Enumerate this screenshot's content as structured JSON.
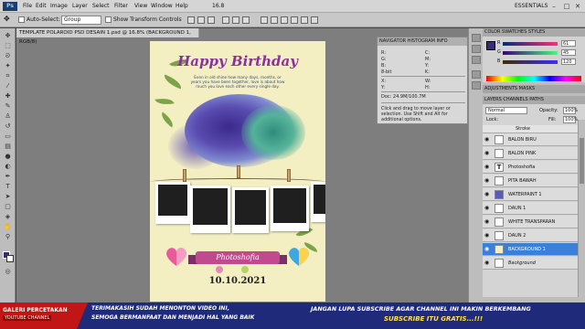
{
  "app": {
    "logo": "Ps",
    "zoom": "16.8",
    "workspace": "ESSENTIALS"
  },
  "menu": [
    "File",
    "Edit",
    "Image",
    "Layer",
    "Select",
    "Filter",
    "View",
    "Window",
    "Help"
  ],
  "options": {
    "auto_select_label": "Auto-Select:",
    "auto_select_value": "Group",
    "transform_label": "Show Transform Controls"
  },
  "document": {
    "tab_title": "TEMPLATE POLAROID PSD DESAIN 1.psd @ 16.8% (BACKGROUND 1, RGB/8)"
  },
  "canvas": {
    "heading": "Happy Birthday",
    "poem": "Even in old shine how many days, months, or years you have been together, love is about how much you love each other every single day.",
    "name": "Photoshofia",
    "date": "10.10.2021"
  },
  "nav_panel": {
    "tabs": "NAVIGATOR HISTOGRAM INFO",
    "r": "R:",
    "g": "G:",
    "b": "B:",
    "bit": "8-bit",
    "c": "C:",
    "m": "M:",
    "y": "Y:",
    "k": "K:",
    "x": "X:",
    "y2": "Y:",
    "w": "W:",
    "h": "H:",
    "doc": "Doc: 24.9M/100.7M",
    "hint": "Click and drag to move layer or selection. Use Shift and Alt for additional options."
  },
  "color_panel": {
    "tabs": "COLOR   SWATCHES   STYLES",
    "r_label": "R",
    "g_label": "G",
    "b_label": "B",
    "r": "61",
    "g": "45",
    "b": "120"
  },
  "adjust_panel": {
    "tabs": "ADJUSTMENTS   MASKS"
  },
  "layers_panel": {
    "tabs": "LAYERS   CHANNELS   PATHS",
    "blend": "Normal",
    "opacity_label": "Opacity:",
    "opacity": "100%",
    "lock_label": "Lock:",
    "fill_label": "Fill:",
    "fill": "100%",
    "stroke": "Stroke",
    "layers": [
      "BALON BIRU",
      "BALON PINK",
      "Photoshofia",
      "PITA BAWAH",
      "WATERPAINT 1",
      "DAUN 1",
      "WHITE TRANSPARAN",
      "DAUN 2",
      "BACKGROUND 1",
      "Background"
    ]
  },
  "banner": {
    "brand": "GALERI PERCETAKAN",
    "brand_sub": "YOUTUBE CHANNEL",
    "line1": "TERIMAKASIH SUDAH MENONTON VIDEO INI,",
    "line2": "SEMOGA BERMANFAAT DAN MENJADI HAL YANG BAIK",
    "line3": "JANGAN LUPA SUBSCRIBE AGAR CHANNEL INI MAKIN BERKEMBANG",
    "line4": "SUBSCRIBE ITU GRATIS...!!!"
  },
  "colors": {
    "accent": "#3a7fd8",
    "heading": "#8e2fa0",
    "banner": "#1f2b7a",
    "brand": "#c21616"
  }
}
